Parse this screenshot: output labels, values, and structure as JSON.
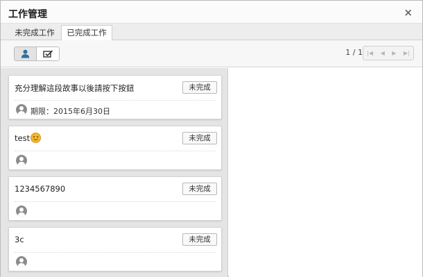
{
  "dialog": {
    "title": "工作管理",
    "close_glyph": "×"
  },
  "tabs": [
    {
      "label": "未完成工作",
      "active": false
    },
    {
      "label": "已完成工作",
      "active": true
    }
  ],
  "toolbar": {
    "view_buttons": [
      {
        "icon": "user-icon",
        "active": true
      },
      {
        "icon": "task-check-icon",
        "active": false
      }
    ],
    "page_info": "1 / 1",
    "pager": {
      "first_glyph": "|◀",
      "prev_glyph": "◀",
      "next_glyph": "▶",
      "last_glyph": "▶|"
    }
  },
  "tasks": [
    {
      "title": "充分理解這段故事以後請按下按鈕",
      "button_label": "未完成",
      "deadline": "期限：2015年6月30日",
      "avatar_icon": "user-avatar-icon"
    },
    {
      "title": "test",
      "emoji": "smiley-icon",
      "button_label": "未完成",
      "deadline": "",
      "avatar_icon": "user-avatar-icon"
    },
    {
      "title": "1234567890",
      "button_label": "未完成",
      "deadline": "",
      "avatar_icon": "user-avatar-icon"
    },
    {
      "title": "3c",
      "button_label": "未完成",
      "deadline": "",
      "avatar_icon": "user-avatar-icon"
    }
  ],
  "colors": {
    "active_tab_bg": "#ffffff",
    "user_icon": "#2f6f9f",
    "avatar": "#8c8c8c",
    "list_bg": "#e5e5e5"
  }
}
